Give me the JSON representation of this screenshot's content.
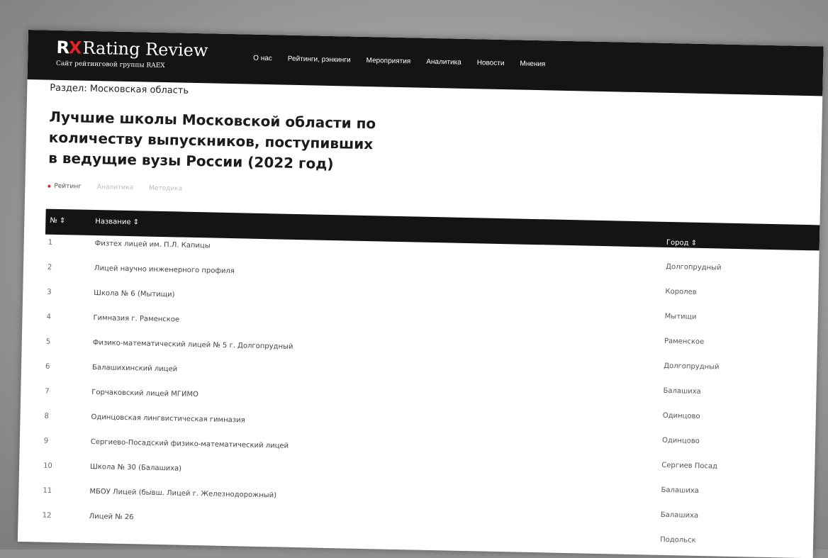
{
  "header": {
    "logo_mark_r": "R",
    "logo_mark_x": "X",
    "logo_title": "Rating Review",
    "logo_subtitle": "Сайт рейтинговой группы RAEX",
    "nav": [
      "О нас",
      "Рейтинги, рэнкинги",
      "Мероприятия",
      "Аналитика",
      "Новости",
      "Мнения"
    ]
  },
  "page": {
    "section": "Раздел: Московская область",
    "title": "Лучшие школы Московской области по количеству выпускников, поступивших в ведущие вузы России (2022 год)"
  },
  "tabs": [
    {
      "label": "Рейтинг",
      "active": true
    },
    {
      "label": "Аналитика",
      "active": false
    },
    {
      "label": "Методика",
      "active": false
    }
  ],
  "table": {
    "columns": {
      "num": "№ ⇕",
      "name": "Название ⇕",
      "city": "Город ⇕"
    },
    "rows": [
      {
        "num": "1",
        "name": "Физтех лицей им. П.Л. Капицы",
        "city": "Долгопрудный"
      },
      {
        "num": "2",
        "name": "Лицей научно инженерного профиля",
        "city": "Королев"
      },
      {
        "num": "3",
        "name": "Школа № 6 (Мытищи)",
        "city": "Мытищи"
      },
      {
        "num": "4",
        "name": "Гимназия г. Раменское",
        "city": "Раменское"
      },
      {
        "num": "5",
        "name": "Физико-математический лицей № 5 г. Долгопрудный",
        "city": "Долгопрудный"
      },
      {
        "num": "6",
        "name": "Балашихинский лицей",
        "city": "Балашиха"
      },
      {
        "num": "7",
        "name": "Горчаковский лицей МГИМО",
        "city": "Одинцово"
      },
      {
        "num": "8",
        "name": "Одинцовская лингвистическая гимназия",
        "city": "Одинцово"
      },
      {
        "num": "9",
        "name": "Сергиево-Посадский физико-математический лицей",
        "city": "Сергиев Посад"
      },
      {
        "num": "10",
        "name": "Школа № 30 (Балашиха)",
        "city": "Балашиха"
      },
      {
        "num": "11",
        "name": "МБОУ Лицей (бывш. Лицей г. Железнодорожный)",
        "city": "Балашиха"
      },
      {
        "num": "12",
        "name": "Лицей № 26",
        "city": "Подольск"
      }
    ]
  },
  "colors": {
    "accent": "#e02424",
    "header_bg": "#141414"
  }
}
